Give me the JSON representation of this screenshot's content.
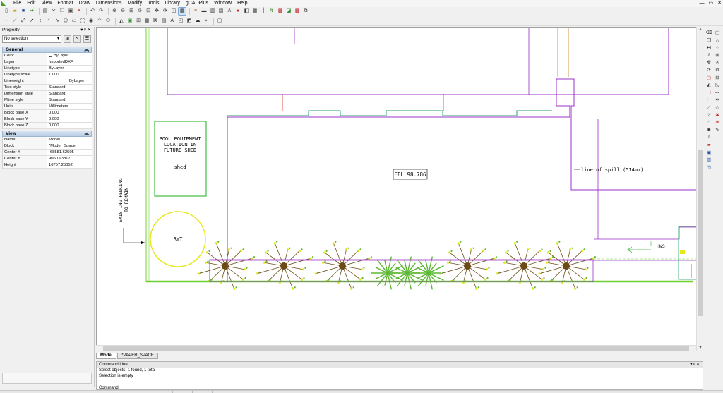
{
  "menu": [
    "File",
    "Edit",
    "View",
    "Format",
    "Draw",
    "Dimensions",
    "Modify",
    "Tools",
    "Library",
    "gCADPlus",
    "Window",
    "Help"
  ],
  "window_controls": {
    "min": "—",
    "restore": "▭",
    "close": "✕"
  },
  "property_panel": {
    "title": "Property",
    "selection": "No selection",
    "general": {
      "header": "General",
      "rows": [
        {
          "key": "Color",
          "value": "ByLayer"
        },
        {
          "key": "Layer",
          "value": "ImportedDXF"
        },
        {
          "key": "Linetype",
          "value": "ByLayer"
        },
        {
          "key": "Linetype scale",
          "value": "1.000"
        },
        {
          "key": "Lineweight",
          "value": "ByLayer"
        },
        {
          "key": "Text style",
          "value": "Standard"
        },
        {
          "key": "Dimension style",
          "value": "Standard"
        },
        {
          "key": "Mline style",
          "value": "Standard"
        },
        {
          "key": "Units",
          "value": "Millimeters"
        },
        {
          "key": "Block base X",
          "value": "0.000"
        },
        {
          "key": "Block base Y",
          "value": "0.000"
        },
        {
          "key": "Block base Z",
          "value": "0.000"
        }
      ]
    },
    "view": {
      "header": "View",
      "rows": [
        {
          "key": "Name",
          "value": "Model"
        },
        {
          "key": "Block",
          "value": "*Model_Space"
        },
        {
          "key": "Center X",
          "value": "-68581.62595"
        },
        {
          "key": "Center Y",
          "value": "9060.93817"
        },
        {
          "key": "Height",
          "value": "16757.25052"
        }
      ]
    }
  },
  "drawing": {
    "pool_equipment": [
      "POOL EQUIPMENT",
      "LOCATION IN",
      "FUTURE SHED"
    ],
    "shed_label": "shed",
    "rwt_label": "RWT",
    "ffl_label": "FFL 98.786",
    "spill_label": "line of spill (514mm)",
    "fencing_label": [
      "EXISTING FENCING",
      "TO REMAIN"
    ],
    "hws_label": "HWS",
    "colors": {
      "boundary": "#9b30c8",
      "green_rect": "#44bb44",
      "teal": "#2aa06a",
      "yellow": "#e6e619",
      "red": "#e03030",
      "orange": "#c8801a",
      "ground": "#70d030",
      "tree": "#6b4a16",
      "fern": "#5ab832"
    }
  },
  "tabs": [
    {
      "label": "Model",
      "active": true
    },
    {
      "label": "*PAPER_SPACE",
      "active": false
    }
  ],
  "command": {
    "title": "Command Line",
    "lines": [
      "Select objects: 1 found,  1 total",
      "Selection is empty"
    ],
    "prompt": "Command:"
  }
}
